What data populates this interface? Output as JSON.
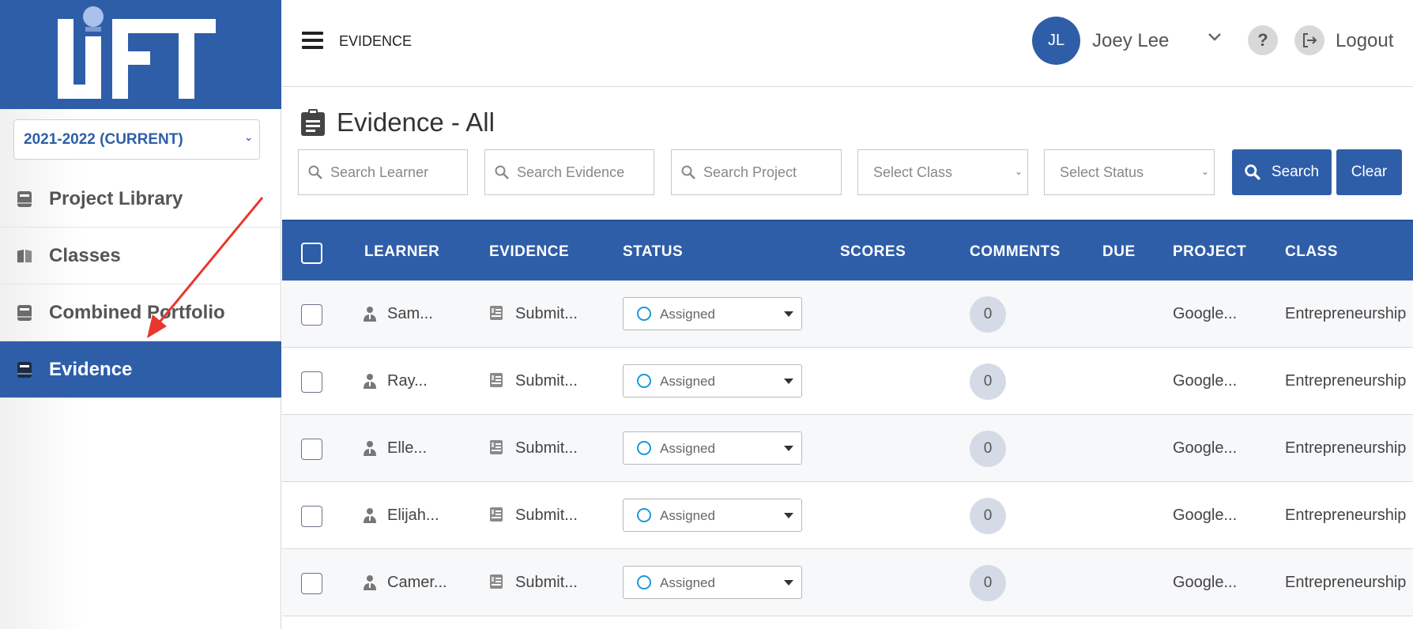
{
  "app": {
    "logo_text": "LiFT"
  },
  "sidebar": {
    "year_select": "2021-2022 (CURRENT)",
    "items": [
      {
        "label": "Project Library",
        "icon": "book-icon",
        "active": false
      },
      {
        "label": "Classes",
        "icon": "open-book-icon",
        "active": false
      },
      {
        "label": "Combined Portfolio",
        "icon": "portfolio-icon",
        "active": false
      },
      {
        "label": "Evidence",
        "icon": "evidence-icon",
        "active": true
      }
    ]
  },
  "header": {
    "breadcrumb": "EVIDENCE",
    "user_initials": "JL",
    "user_name": "Joey Lee",
    "help_label": "?",
    "logout_label": "Logout"
  },
  "page": {
    "title": "Evidence - All"
  },
  "filters": {
    "learner_placeholder": "Search Learner",
    "evidence_placeholder": "Search Evidence",
    "project_placeholder": "Search Project",
    "class_placeholder": "Select Class",
    "status_placeholder": "Select Status",
    "search_button": "Search",
    "clear_button": "Clear"
  },
  "table": {
    "columns": [
      "LEARNER",
      "EVIDENCE",
      "STATUS",
      "SCORES",
      "COMMENTS",
      "DUE",
      "PROJECT",
      "CLASS"
    ],
    "rows": [
      {
        "learner": "Sam...",
        "evidence": "Submit...",
        "status": "Assigned",
        "scores": "",
        "comments": "0",
        "due": "",
        "project": "Google...",
        "class": "Entrepreneurship"
      },
      {
        "learner": "Ray...",
        "evidence": "Submit...",
        "status": "Assigned",
        "scores": "",
        "comments": "0",
        "due": "",
        "project": "Google...",
        "class": "Entrepreneurship"
      },
      {
        "learner": "Elle...",
        "evidence": "Submit...",
        "status": "Assigned",
        "scores": "",
        "comments": "0",
        "due": "",
        "project": "Google...",
        "class": "Entrepreneurship"
      },
      {
        "learner": "Elijah...",
        "evidence": "Submit...",
        "status": "Assigned",
        "scores": "",
        "comments": "0",
        "due": "",
        "project": "Google...",
        "class": "Entrepreneurship"
      },
      {
        "learner": "Camer...",
        "evidence": "Submit...",
        "status": "Assigned",
        "scores": "",
        "comments": "0",
        "due": "",
        "project": "Google...",
        "class": "Entrepreneurship"
      }
    ]
  },
  "colors": {
    "brand": "#2f5ea8",
    "annotation_arrow": "#e8372c",
    "status_circle": "#1a9ad6"
  }
}
